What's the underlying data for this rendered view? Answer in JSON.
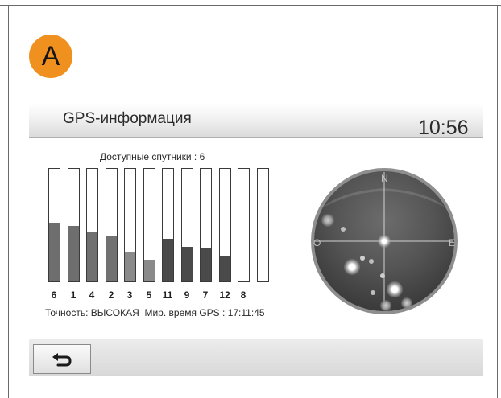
{
  "badge": {
    "letter": "A",
    "color": "#f0901e"
  },
  "header": {
    "title": "GPS-информация",
    "time": "10:56"
  },
  "satellites": {
    "count_label": "Доступные спутники : 6",
    "bars": [
      {
        "id": "6",
        "level": 0.52,
        "tone": "#6e6e6e"
      },
      {
        "id": "1",
        "level": 0.49,
        "tone": "#6e6e6e"
      },
      {
        "id": "4",
        "level": 0.44,
        "tone": "#707070"
      },
      {
        "id": "2",
        "level": 0.4,
        "tone": "#717171"
      },
      {
        "id": "3",
        "level": 0.26,
        "tone": "#8a8a8a"
      },
      {
        "id": "5",
        "level": 0.19,
        "tone": "#8a8a8a"
      },
      {
        "id": "11",
        "level": 0.38,
        "tone": "#4a4a4a"
      },
      {
        "id": "9",
        "level": 0.31,
        "tone": "#4a4a4a"
      },
      {
        "id": "7",
        "level": 0.29,
        "tone": "#4a4a4a"
      },
      {
        "id": "12",
        "level": 0.23,
        "tone": "#4a4a4a"
      },
      {
        "id": "8",
        "level": 0.0,
        "tone": "#ffffff"
      },
      {
        "id": "",
        "level": 0.0,
        "tone": "#ffffff"
      }
    ]
  },
  "status": {
    "accuracy_label": "Точность:",
    "accuracy_value": "ВЫСОКАЯ",
    "gps_time_label": "Мир. время GPS :",
    "gps_time_value": "17:11:45"
  },
  "radar": {
    "north": "N",
    "west": "O",
    "east": "E"
  },
  "footer": {
    "back_icon": "return-arrow-icon"
  }
}
